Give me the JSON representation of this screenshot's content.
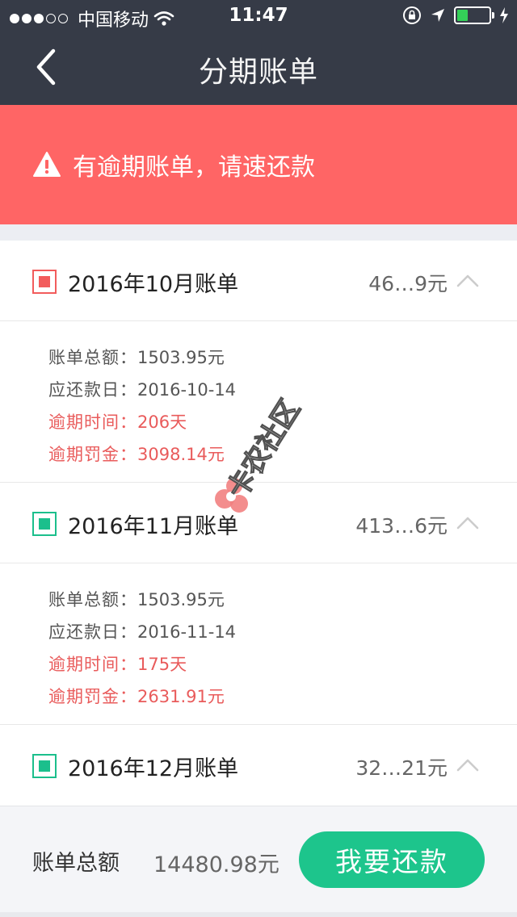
{
  "status": {
    "carrier": "中国移动",
    "time": "11:47",
    "signal": [
      true,
      true,
      true,
      false,
      false
    ],
    "battery_level": 0.35,
    "battery_color": "#34d058"
  },
  "nav": {
    "title": "分期账单",
    "back_icon": "chevron-left-icon"
  },
  "alert": {
    "text": "有逾期账单，请速还款",
    "icon": "warning-icon",
    "bg": "#ff6565"
  },
  "bills": [
    {
      "title": "2016年10月账单",
      "amount": "46…9元",
      "status_color": "#f25c5c",
      "expanded": true,
      "details": {
        "total_label": "账单总额：",
        "total_value": "1503.95元",
        "due_label": "应还款日：",
        "due_value": "2016-10-14",
        "overdue_label": "逾期时间：",
        "overdue_value": "206天",
        "penalty_label": "逾期罚金：",
        "penalty_value": "3098.14元"
      }
    },
    {
      "title": "2016年11月账单",
      "amount": "413…6元",
      "status_color": "#1bbf8c",
      "expanded": true,
      "details": {
        "total_label": "账单总额：",
        "total_value": "1503.95元",
        "due_label": "应还款日：",
        "due_value": "2016-11-14",
        "overdue_label": "逾期时间：",
        "overdue_value": "175天",
        "penalty_label": "逾期罚金：",
        "penalty_value": "2631.91元"
      }
    },
    {
      "title": "2016年12月账单",
      "amount": "32…21元",
      "status_color": "#1bbf8c",
      "expanded": false
    }
  ],
  "watermark": {
    "text": "卡农社区"
  },
  "footer": {
    "label": "账单总额",
    "total": "14480.98元",
    "button": "我要还款",
    "button_color": "#1dc58c"
  }
}
